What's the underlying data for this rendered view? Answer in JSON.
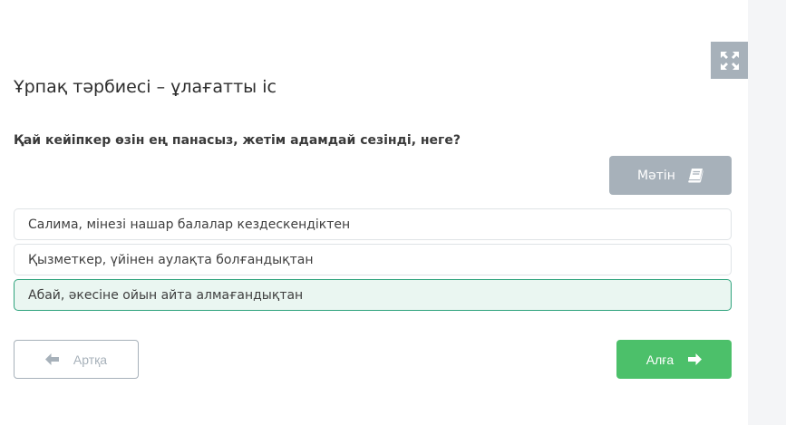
{
  "page": {
    "title": "Ұрпақ тәрбиесі – ұлағатты іс"
  },
  "question": {
    "text": "Қай кейіпкер өзін ең панасыз, жетім адамдай сезінді, неге?"
  },
  "text_button": {
    "label": "Мәтін",
    "icon": "book-icon"
  },
  "fullscreen_button": {
    "icon": "expand-arrows-icon"
  },
  "answers": [
    {
      "label": "Салима, мінезі нашар балалар кездескендіктен",
      "selected": false
    },
    {
      "label": "Қызметкер, үйінен аулақта болғандықтан",
      "selected": false
    },
    {
      "label": "Абай, әкесіне ойын айта алмағандықтан",
      "selected": true
    }
  ],
  "navigation": {
    "back_label": "Артқа",
    "back_icon": "arrow-left-icon",
    "next_label": "Алға",
    "next_icon": "arrow-right-icon"
  },
  "colors": {
    "gray_button": "#a7b1ba",
    "accent_green": "#4cc06a",
    "selected_border": "#2fa37d",
    "selected_bg": "#eaf6f1"
  }
}
